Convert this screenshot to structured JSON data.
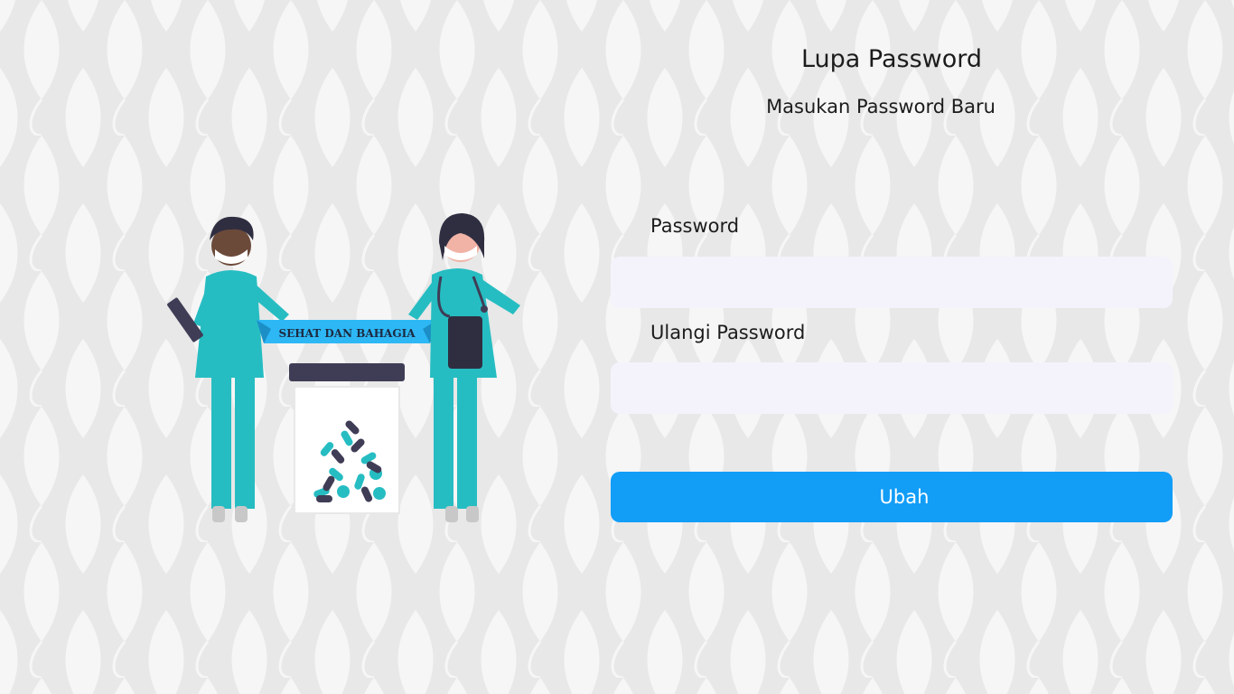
{
  "header": {
    "title": "Lupa Password",
    "subtitle": "Masukan Password Baru"
  },
  "form": {
    "password_label": "Password",
    "password_value": "",
    "confirm_label": "Ulangi Password",
    "confirm_value": "",
    "submit_label": "Ubah"
  },
  "illustration": {
    "banner_text": "SEHAT DAN BAHAGIA"
  },
  "colors": {
    "background": "#e8e8e8",
    "pattern": "#f5f5f5",
    "accent": "#129df7",
    "input_bg": "#f4f3fc",
    "scrubs": "#26bdc2",
    "banner": "#2db7f5"
  }
}
